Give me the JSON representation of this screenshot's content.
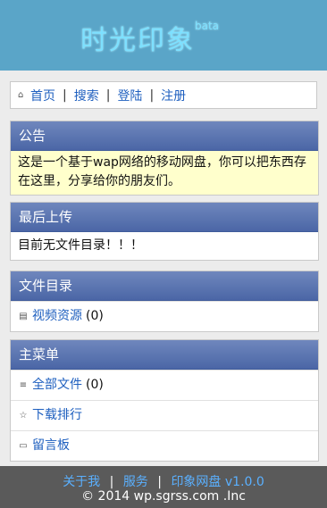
{
  "logo": {
    "text": "时光印象",
    "sup": "bata"
  },
  "nav": {
    "home": "首页",
    "search": "搜索",
    "login": "登陆",
    "register": "注册",
    "sep": "|"
  },
  "notice": {
    "title": "公告",
    "text": "这是一个基于wap网络的移动网盘，你可以把东西存在这里，分享给你的朋友们。"
  },
  "latest": {
    "title": "最后上传",
    "text": "目前无文件目录！！！"
  },
  "files": {
    "title": "文件目录",
    "items": [
      {
        "label": "视频资源",
        "count": "(0)"
      }
    ]
  },
  "menu": {
    "title": "主菜单",
    "all_files": "全部文件",
    "all_count": "(0)",
    "ranking": "下载排行",
    "guestbook": "留言板"
  },
  "footer": {
    "about": "关于我",
    "service": "服务",
    "app": "印象网盘 v1.0.0",
    "sep": "|",
    "copyright": "© 2014 wp.sgrss.com .Inc"
  }
}
